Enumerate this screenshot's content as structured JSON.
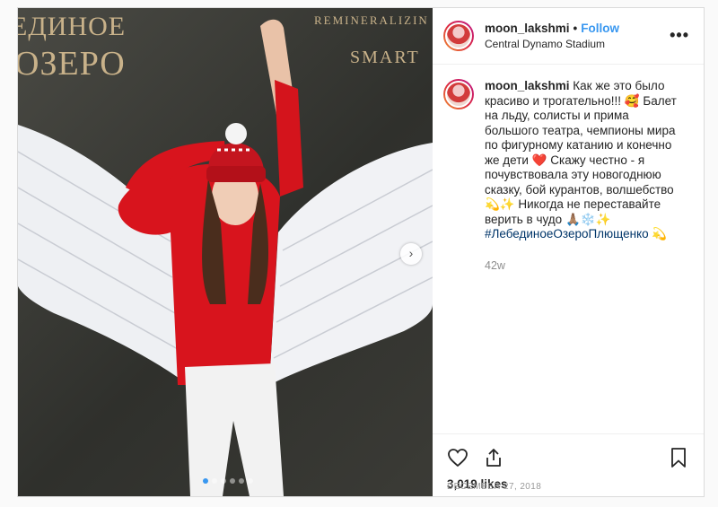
{
  "photo": {
    "sign_line1": "ЕДИНОЕ",
    "sign_line2": "ОЗЕРО",
    "brand_line1": "REMINERALIZIN",
    "brand_line2": "SMART",
    "next_icon": "chevron-right-icon",
    "dot_count": 6,
    "active_dot": 0
  },
  "header": {
    "username": "moon_lakshmi",
    "bullet": "•",
    "follow_label": "Follow",
    "location": "Central Dynamo Stadium",
    "more_icon": "more-options-icon",
    "more_label": "•••"
  },
  "caption": {
    "username": "moon_lakshmi",
    "text": "Как же это было красиво и трогательно!!! 🥰 Балет на льду, солисты и прима большого театра, чемпионы мира по фигурному катанию и конечно же дети ❤️ Скажу честно - я почувствовала эту новогоднюю сказку, бой курантов, волшебство 💫✨ Никогда не переставайте верить в чудо 🙏🏽❄️✨",
    "hashtag": "#ЛебединоеОзероПлющенко",
    "hashtag_suffix": " 💫",
    "time_ago": "42w"
  },
  "actions": {
    "like_icon": "heart-icon",
    "share_icon": "share-icon",
    "save_icon": "bookmark-icon",
    "likes": "3,019 likes",
    "date": "DECEMBER 27, 2018"
  },
  "colors": {
    "link": "#3897f0",
    "hashtag": "#003569",
    "muted": "#8e8e8e"
  }
}
